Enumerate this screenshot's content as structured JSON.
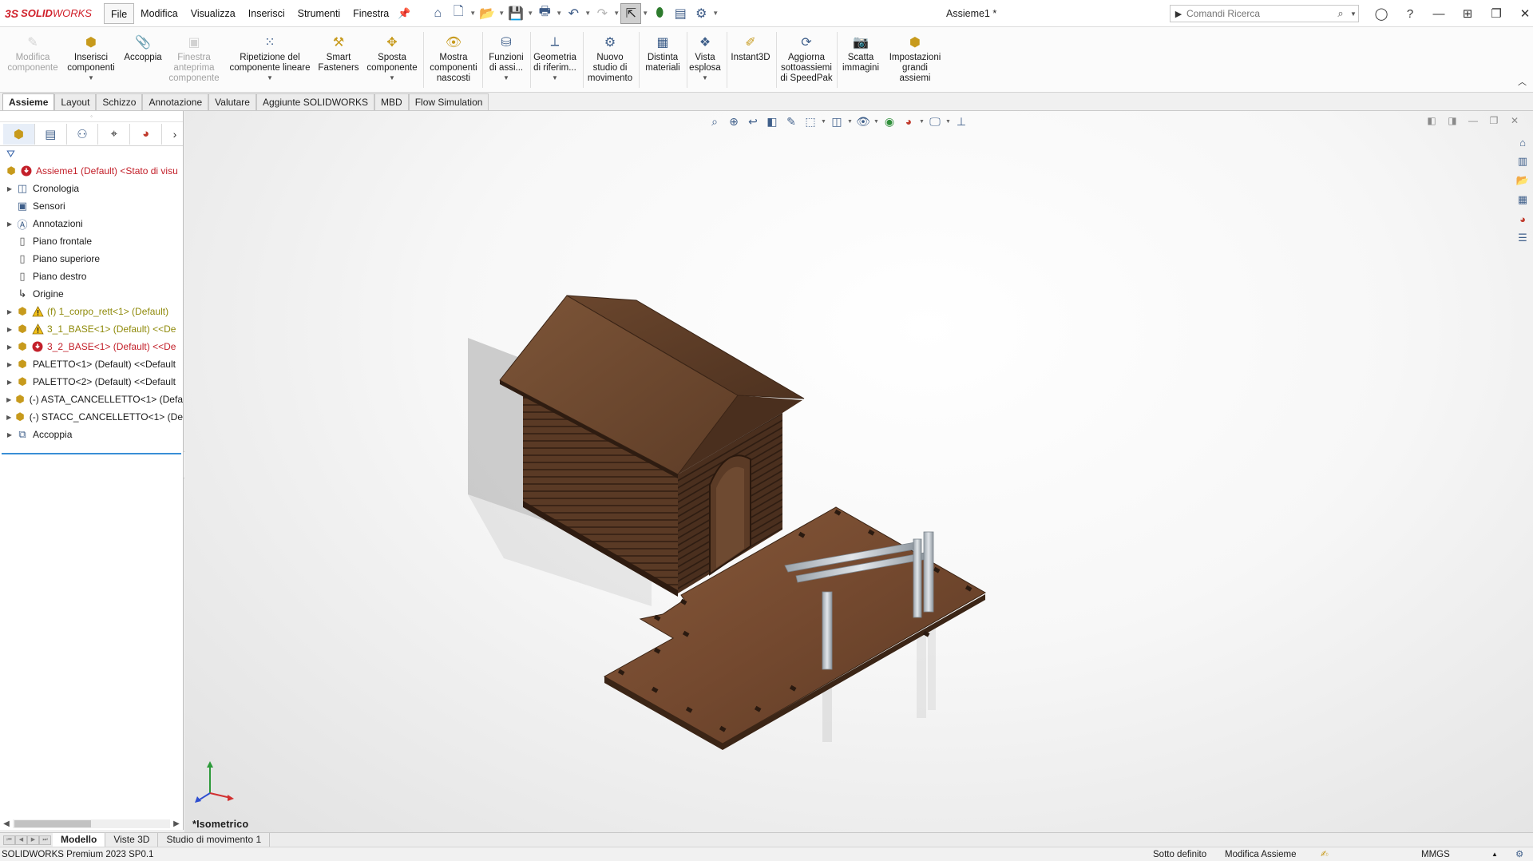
{
  "app": {
    "logo_ds": "3S",
    "logo_solid": "SOLID",
    "logo_works": "WORKS",
    "document_title": "Assieme1 *"
  },
  "menu": [
    "File",
    "Modifica",
    "Visualizza",
    "Inserisci",
    "Strumenti",
    "Finestra"
  ],
  "search": {
    "placeholder": "Comandi Ricerca"
  },
  "ribbon": {
    "buttons": [
      {
        "label": "Modifica\ncomponente",
        "disabled": true,
        "icon": "edit-component-icon"
      },
      {
        "label": "Inserisci\ncomponenti",
        "disabled": false,
        "icon": "insert-components-icon"
      },
      {
        "label": "Accoppia",
        "disabled": false,
        "icon": "mate-icon"
      },
      {
        "label": "Finestra\nanteprima\ncomponente",
        "disabled": true,
        "icon": "preview-window-icon"
      },
      {
        "label": "Ripetizione del\ncomponente lineare",
        "disabled": false,
        "icon": "linear-pattern-icon"
      },
      {
        "label": "Smart\nFasteners",
        "disabled": false,
        "icon": "smart-fasteners-icon"
      },
      {
        "label": "Sposta\ncomponente",
        "disabled": false,
        "icon": "move-component-icon"
      },
      {
        "label": "Mostra\ncomponenti\nnascosti",
        "disabled": false,
        "icon": "show-hidden-icon"
      },
      {
        "label": "Funzioni\ndi assi...",
        "disabled": false,
        "icon": "assembly-features-icon"
      },
      {
        "label": "Geometria\ndi riferim...",
        "disabled": false,
        "icon": "reference-geometry-icon"
      },
      {
        "label": "Nuovo\nstudio di\nmovimento",
        "disabled": false,
        "icon": "motion-study-icon"
      },
      {
        "label": "Distinta\nmateriali",
        "disabled": false,
        "icon": "bom-icon"
      },
      {
        "label": "Vista\nesplosa",
        "disabled": false,
        "icon": "exploded-view-icon"
      },
      {
        "label": "Instant3D",
        "disabled": false,
        "icon": "instant3d-icon"
      },
      {
        "label": "Aggiorna\nsottoassiemi\ndi SpeedPak",
        "disabled": false,
        "icon": "speedpak-icon"
      },
      {
        "label": "Scatta\nimmagini",
        "disabled": false,
        "icon": "snapshot-icon"
      },
      {
        "label": "Impostazioni\ngrandi\nassiemi",
        "disabled": false,
        "icon": "large-assembly-icon"
      }
    ]
  },
  "command_tabs": [
    "Assieme",
    "Layout",
    "Schizzo",
    "Annotazione",
    "Valutare",
    "Aggiunte SOLIDWORKS",
    "MBD",
    "Flow Simulation"
  ],
  "tree": [
    {
      "label": "Assieme1 (Default) <Stato di visu",
      "color": "red",
      "icon": "assembly-icon",
      "status": "error",
      "expander": false
    },
    {
      "label": "Cronologia",
      "color": "normal",
      "icon": "history-icon",
      "expander": true
    },
    {
      "label": "Sensori",
      "color": "normal",
      "icon": "sensor-icon",
      "expander": false
    },
    {
      "label": "Annotazioni",
      "color": "normal",
      "icon": "annotation-icon",
      "expander": true
    },
    {
      "label": "Piano frontale",
      "color": "normal",
      "icon": "plane-icon",
      "expander": false
    },
    {
      "label": "Piano superiore",
      "color": "normal",
      "icon": "plane-icon",
      "expander": false
    },
    {
      "label": "Piano destro",
      "color": "normal",
      "icon": "plane-icon",
      "expander": false
    },
    {
      "label": "Origine",
      "color": "normal",
      "icon": "origin-icon",
      "expander": false
    },
    {
      "label": "(f) 1_corpo_rett<1> (Default)",
      "color": "olive",
      "icon": "part-icon",
      "status": "warning",
      "expander": true
    },
    {
      "label": "3_1_BASE<1> (Default) <<De",
      "color": "olive",
      "icon": "part-icon",
      "status": "warning",
      "expander": true
    },
    {
      "label": "3_2_BASE<1> (Default) <<De",
      "color": "red",
      "icon": "part-icon",
      "status": "error",
      "expander": true
    },
    {
      "label": "PALETTO<1> (Default) <<Default",
      "color": "normal",
      "icon": "part-icon",
      "expander": true
    },
    {
      "label": "PALETTO<2> (Default) <<Default",
      "color": "normal",
      "icon": "part-icon",
      "expander": true
    },
    {
      "label": "(-) ASTA_CANCELLETTO<1> (Defa",
      "color": "normal",
      "icon": "part-icon",
      "expander": true
    },
    {
      "label": "(-) STACC_CANCELLETTO<1> (De",
      "color": "normal",
      "icon": "part-icon",
      "expander": true
    },
    {
      "label": "Accoppia",
      "color": "normal",
      "icon": "mates-folder-icon",
      "expander": true
    }
  ],
  "viewport": {
    "view_name": "*Isometrico"
  },
  "bottom_tabs": [
    "Modello",
    "Viste 3D",
    "Studio di movimento 1"
  ],
  "status": {
    "version": "SOLIDWORKS Premium 2023 SP0.1",
    "definition": "Sotto definito",
    "mode": "Modifica Assieme",
    "units": "MMGS"
  },
  "colors": {
    "brand": "#d0202a",
    "wood_light": "#7a5236",
    "wood_dark": "#4e3322",
    "selection": "#3a8fd6"
  }
}
